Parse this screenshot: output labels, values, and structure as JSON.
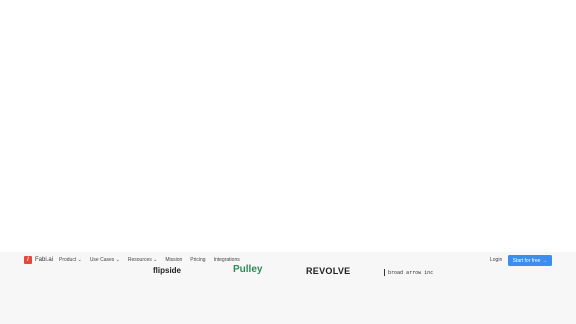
{
  "brand": {
    "name": "Fabi.ai",
    "mark": "/"
  },
  "nav": {
    "items": [
      "Product ⌄",
      "Use Cases ⌄",
      "Resources ⌄",
      "Mission",
      "Pricing",
      "Integrations"
    ],
    "login": "Login",
    "cta": "Start for free",
    "cta_arrow": "→"
  },
  "customers": [
    "flipside",
    "Pulley",
    "REVOLVE",
    "broad arrow inc"
  ],
  "colors": {
    "accent": "#3b8ef0",
    "brand": "#e8463a",
    "pulley": "#2e8b57"
  }
}
